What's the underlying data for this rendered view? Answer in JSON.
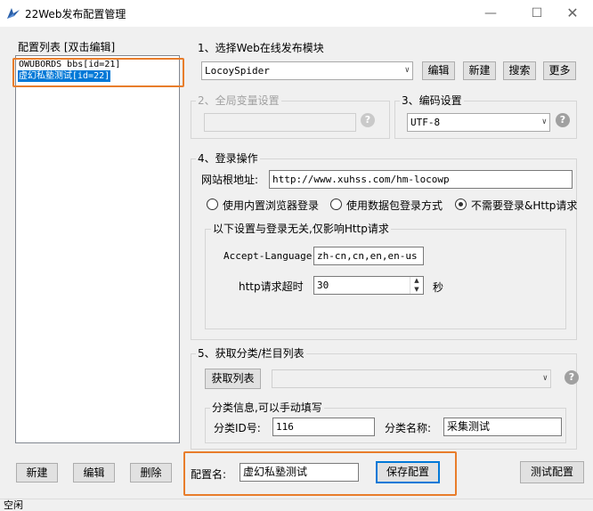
{
  "window": {
    "title": "22Web发布配置管理",
    "minimize_icon": "minimize-icon",
    "maximize_icon": "maximize-icon",
    "close_icon": "close-icon"
  },
  "config_list": {
    "title": "配置列表 [双击编辑]",
    "items": [
      {
        "label": "OWUBORDS bbs[id=21]",
        "selected": false
      },
      {
        "label": "虚幻私塾测试[id=22]",
        "selected": true
      }
    ]
  },
  "section1": {
    "title": "1、选择Web在线发布模块",
    "module_value": "LocoySpider",
    "buttons": [
      "编辑",
      "新建",
      "搜索",
      "更多"
    ]
  },
  "section2": {
    "title": "2、全局变量设置",
    "value": ""
  },
  "section3": {
    "title": "3、编码设置",
    "encoding_value": "UTF-8"
  },
  "section4": {
    "title": "4、登录操作",
    "site_root_label": "网站根地址:",
    "site_root_value": "http://www.xuhss.com/hm-locowp",
    "radio_options": [
      {
        "label": "使用内置浏览器登录",
        "checked": false
      },
      {
        "label": "使用数据包登录方式",
        "checked": true
      },
      {
        "label": "不需要登录&Http请求",
        "checked": false
      }
    ],
    "http_group_title": "以下设置与登录无关,仅影响Http请求",
    "accept_language_label": "Accept-Language",
    "accept_language_value": "zh-cn,cn,en,en-us",
    "timeout_label": "http请求超时",
    "timeout_value": "30",
    "timeout_unit": "秒"
  },
  "section5": {
    "title": "5、获取分类/栏目列表",
    "get_list_button": "获取列表",
    "category_select_value": "",
    "category_info_title": "分类信息,可以手动填写",
    "category_id_label": "分类ID号:",
    "category_id_value": "116",
    "category_name_label": "分类名称:",
    "category_name_value": "采集测试"
  },
  "bottom": {
    "new_button": "新建",
    "edit_button": "编辑",
    "delete_button": "删除",
    "config_name_label": "配置名:",
    "config_name_value": "虚幻私塾测试",
    "save_button": "保存配置",
    "test_button": "测试配置"
  },
  "status": {
    "text": "空闲"
  },
  "colors": {
    "selection": "#0078d7",
    "highlight": "#e87d2b",
    "window_bg": "#f0f0f0"
  }
}
